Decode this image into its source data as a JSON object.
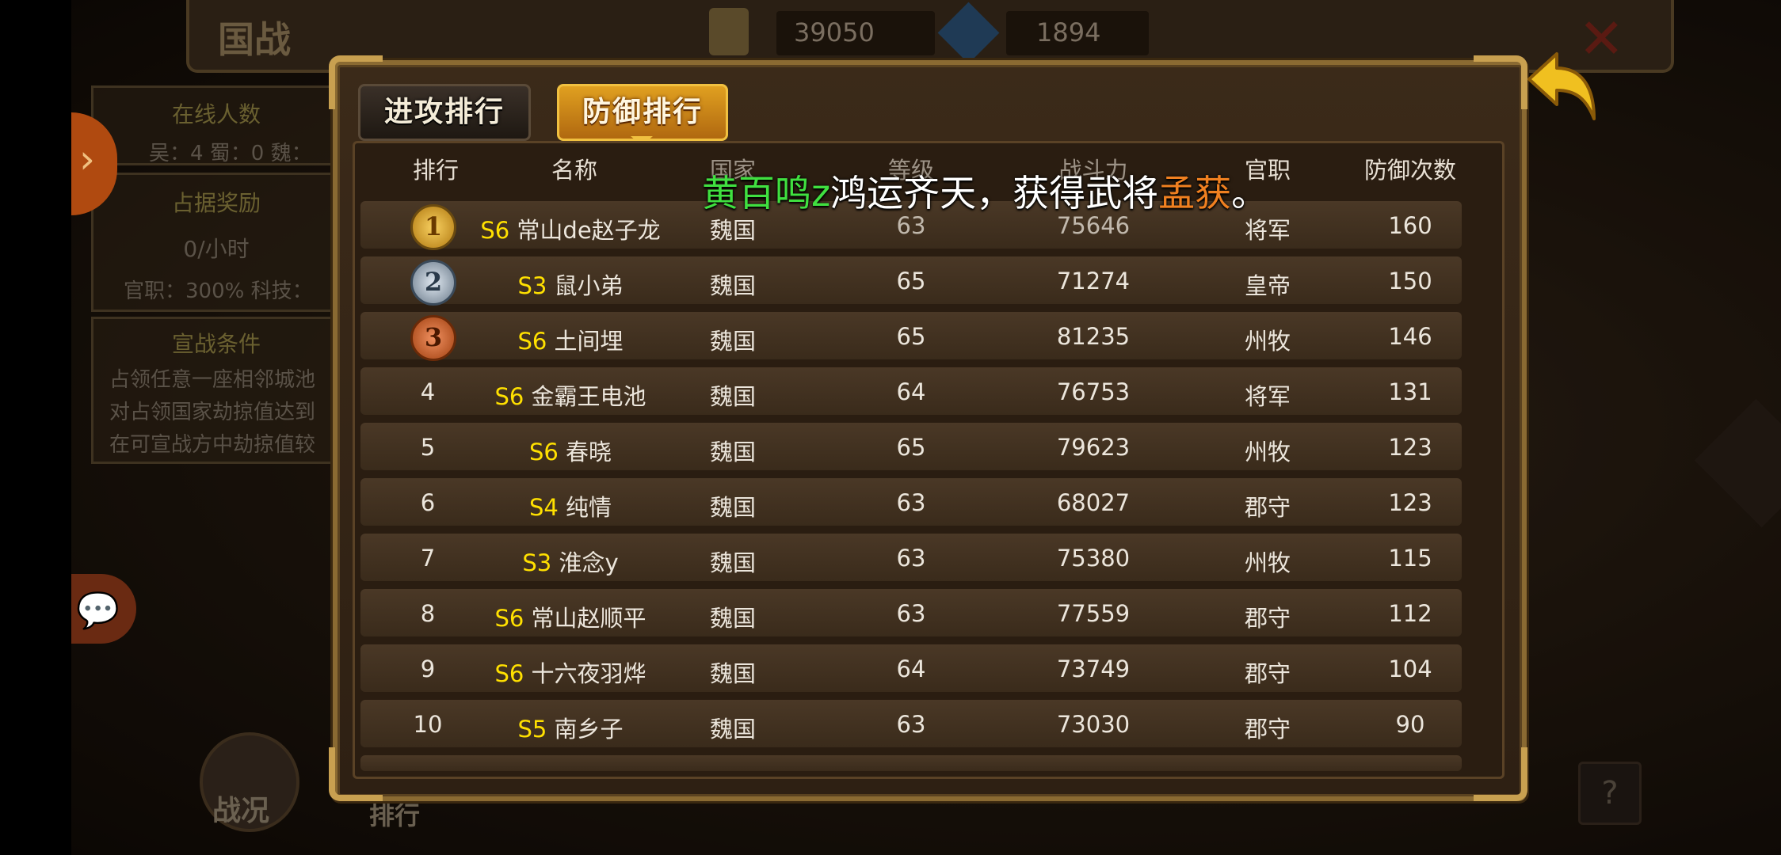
{
  "background": {
    "title": "国战",
    "resource_1": "39050",
    "resource_2": "1894",
    "online_title": "在线人数",
    "online_text": "吴：4  蜀：0  魏：",
    "reward_title": "占据奖励",
    "reward_value": "0/小时",
    "reward_bonus": "官职：300%  科技：",
    "condition_title": "宣战条件",
    "condition_lines": [
      "占领任意一座相邻城池",
      "对占领国家劫掠值达到",
      "在可宣战方中劫掠值较"
    ],
    "battle_label": "战况",
    "rank_label": "排行",
    "help_label": "?"
  },
  "tabs": {
    "attack": "进攻排行",
    "defense": "防御排行"
  },
  "headers": [
    "排行",
    "名称",
    "国家",
    "等级",
    "战斗力",
    "官职",
    "防御次数"
  ],
  "rows": [
    {
      "rank": "1",
      "level": "S6",
      "name": "常山de赵子龙",
      "country": "魏国",
      "lv": "63",
      "power": "75646",
      "title": "将军",
      "defense": "160"
    },
    {
      "rank": "2",
      "level": "S3",
      "name": "鼠小弟",
      "country": "魏国",
      "lv": "65",
      "power": "71274",
      "title": "皇帝",
      "defense": "150"
    },
    {
      "rank": "3",
      "level": "S6",
      "name": "土间埋",
      "country": "魏国",
      "lv": "65",
      "power": "81235",
      "title": "州牧",
      "defense": "146"
    },
    {
      "rank": "4",
      "level": "S6",
      "name": "金霸王电池",
      "country": "魏国",
      "lv": "64",
      "power": "76753",
      "title": "将军",
      "defense": "131"
    },
    {
      "rank": "5",
      "level": "S6",
      "name": "春晓",
      "country": "魏国",
      "lv": "65",
      "power": "79623",
      "title": "州牧",
      "defense": "123"
    },
    {
      "rank": "6",
      "level": "S4",
      "name": "纯情",
      "country": "魏国",
      "lv": "63",
      "power": "68027",
      "title": "郡守",
      "defense": "123"
    },
    {
      "rank": "7",
      "level": "S3",
      "name": "淮念y",
      "country": "魏国",
      "lv": "63",
      "power": "75380",
      "title": "州牧",
      "defense": "115"
    },
    {
      "rank": "8",
      "level": "S6",
      "name": "常山赵顺平",
      "country": "魏国",
      "lv": "63",
      "power": "77559",
      "title": "郡守",
      "defense": "112"
    },
    {
      "rank": "9",
      "level": "S6",
      "name": "十六夜羽烨",
      "country": "魏国",
      "lv": "64",
      "power": "73749",
      "title": "郡守",
      "defense": "104"
    },
    {
      "rank": "10",
      "level": "S5",
      "name": "南乡子",
      "country": "魏国",
      "lv": "63",
      "power": "73030",
      "title": "郡守",
      "defense": "90"
    }
  ],
  "banner": {
    "player": "黄百鸣z",
    "middle": "鸿运齐天，获得武将",
    "hero": "孟获",
    "end": "。"
  },
  "medal_colors": [
    "#d49a20",
    "#8a9aaa",
    "#c0602a"
  ]
}
